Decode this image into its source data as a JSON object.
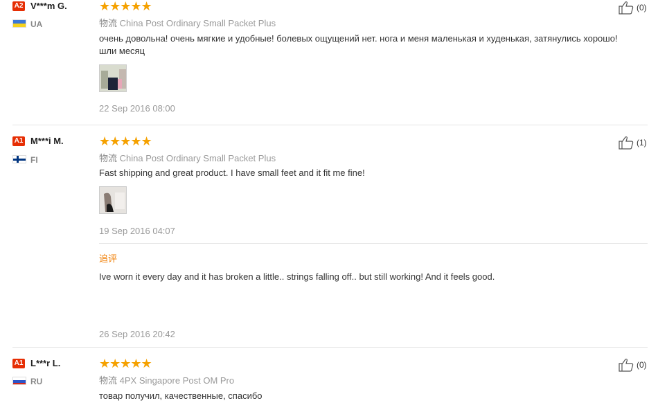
{
  "colors": {
    "badge": "#e62e04",
    "star": "#f5a100",
    "followup": "#f07c00"
  },
  "reviews": [
    {
      "level": "A2",
      "name": "V***m G.",
      "country": "UA",
      "stars": "★★★★★",
      "shipping_label": "物流",
      "shipping": "China Post Ordinary Small Packet Plus",
      "text": "очень довольна! очень мягкие и удобные! болевых ощущений нет. нога и меня маленькая и худенькая, затянулись хорошо! шли месяц",
      "date": "22 Sep 2016 08:00",
      "likes": "(0)"
    },
    {
      "level": "A1",
      "name": "M***i M.",
      "country": "FI",
      "stars": "★★★★★",
      "shipping_label": "物流",
      "shipping": "China Post Ordinary Small Packet Plus",
      "text": "Fast shipping and great product. I have small feet and it fit me fine!",
      "date": "19 Sep 2016 04:07",
      "likes": "(1)",
      "followup_label": "追评",
      "followup_text": "Ive worn it every day and it has broken a little.. strings falling off.. but still working! And it feels good.",
      "followup_date": "26 Sep 2016 20:42"
    },
    {
      "level": "A1",
      "name": "L***r L.",
      "country": "RU",
      "stars": "★★★★★",
      "shipping_label": "物流",
      "shipping": "4PX Singapore Post OM Pro",
      "text": "товар получил, качественные, спасибо",
      "likes": "(0)"
    }
  ]
}
